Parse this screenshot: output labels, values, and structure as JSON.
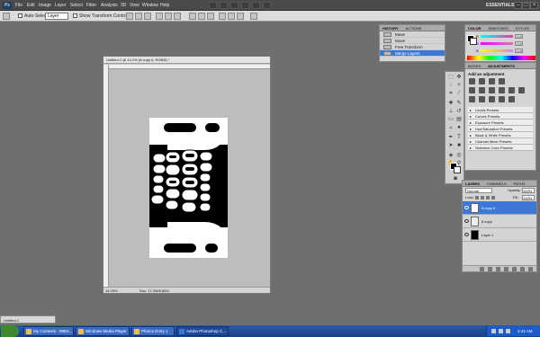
{
  "app": {
    "logo": "Ps",
    "menu": [
      "File",
      "Edit",
      "Image",
      "Layer",
      "Select",
      "Filter",
      "Analysis",
      "3D",
      "View",
      "Window",
      "Help"
    ],
    "workspace": "ESSENTIALS ▾",
    "window_controls": [
      "–",
      "□",
      "×"
    ]
  },
  "options_bar": {
    "auto_select_label": "Auto-Select:",
    "auto_select_value": "Layer",
    "show_transform_label": "Show Transform Controls"
  },
  "document": {
    "tab_title": "Untitled-1 @ 14.2% (8 copy 6, RGB/8) *",
    "zoom": "14.29%",
    "doc_info": "Doc: 17.2M/8.82M"
  },
  "history": {
    "tabs": [
      "HISTORY",
      "ACTIONS"
    ],
    "items": [
      "Move",
      "Move",
      "Free Transform",
      "Merge Layers"
    ],
    "selected_index": 3
  },
  "color_panel": {
    "tabs": [
      "COLOR",
      "SWATCHES",
      "STYLES"
    ],
    "channels": [
      {
        "label": "R",
        "value": "255",
        "color": "#e13c9a"
      },
      {
        "label": "G",
        "value": "255",
        "color": "#e66ac0"
      },
      {
        "label": "B",
        "value": "255",
        "color": "#c58ad8"
      }
    ]
  },
  "adjustments": {
    "tabs": [
      "MASKS",
      "ADJUSTMENTS"
    ],
    "title": "Add an adjustment",
    "presets": [
      "Levels Presets",
      "Curves Presets",
      "Exposure Presets",
      "Hue/Saturation Presets",
      "Black & White Presets",
      "Channel Mixer Presets",
      "Selective Color Presets"
    ]
  },
  "layers": {
    "tabs": [
      "LAYERS",
      "CHANNELS",
      "PATHS"
    ],
    "blend_mode": "Normal",
    "opacity_label": "Opacity:",
    "opacity": "100%",
    "lock_label": "Lock:",
    "fill_label": "Fill:",
    "fill": "100%",
    "items": [
      {
        "name": "8 copy 6",
        "selected": true
      },
      {
        "name": "8 copy",
        "selected": false
      },
      {
        "name": "Layer 1",
        "selected": false
      }
    ]
  },
  "minimized_doc": "Untitled-1",
  "taskbar": {
    "tasks": [
      "My Contests - 99De...",
      "Windows Media Player",
      "Photos Entry 1",
      "Adobe Photoshop C..."
    ],
    "active_index": 3,
    "clock": "3:41 AM"
  }
}
